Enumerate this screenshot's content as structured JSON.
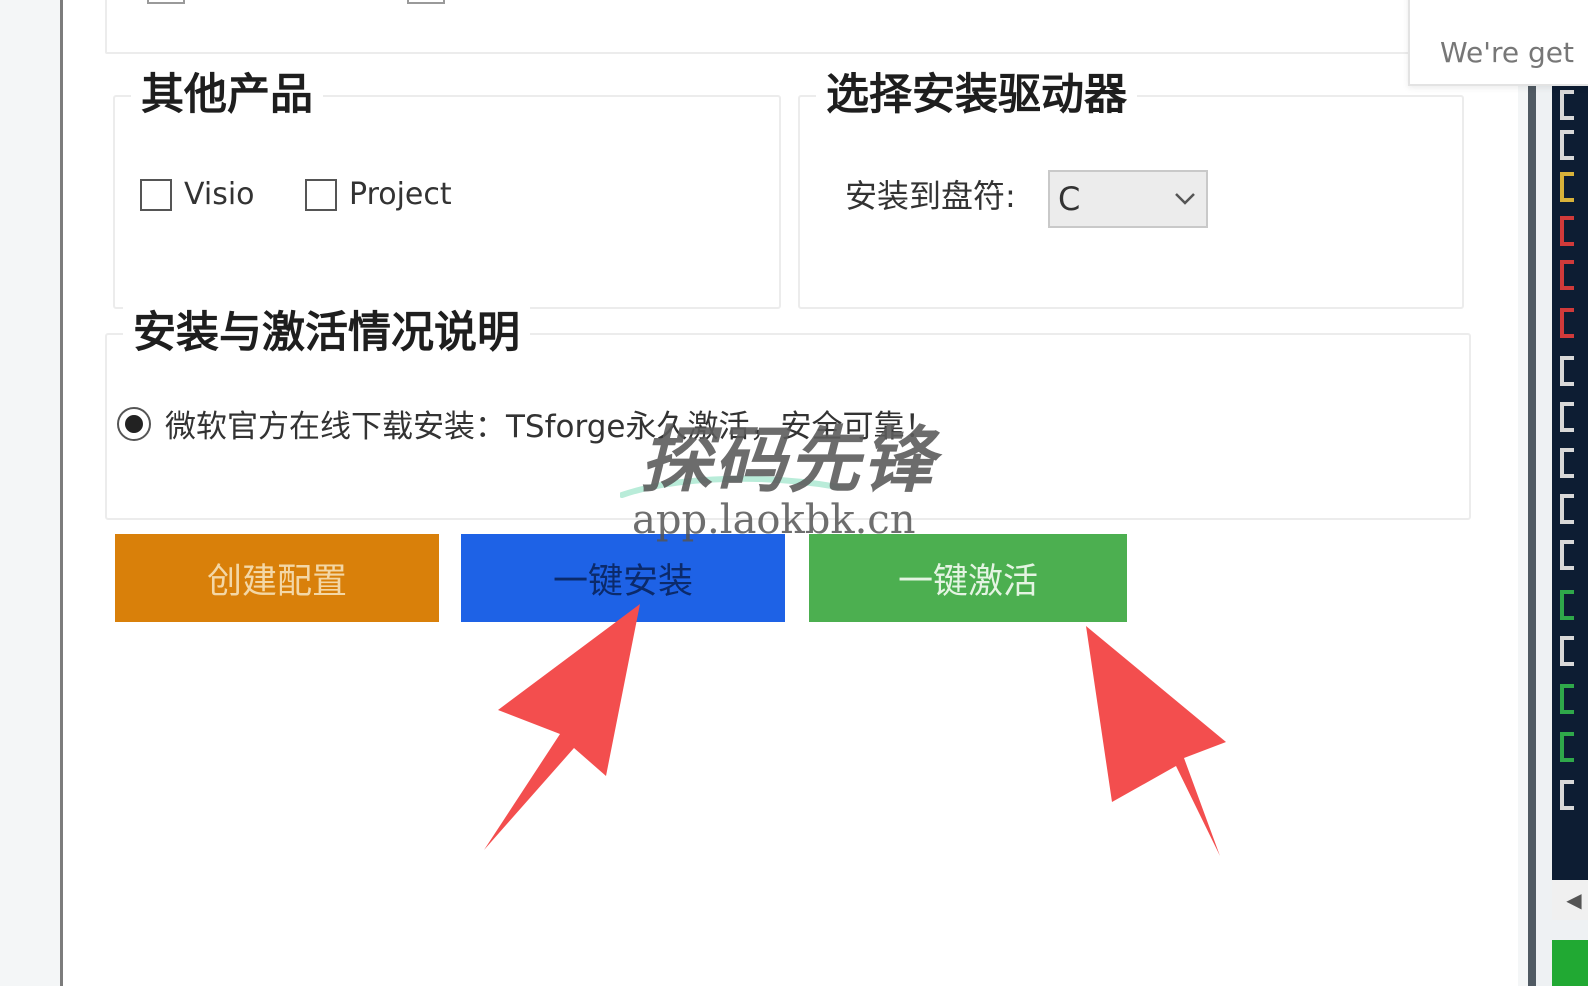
{
  "other_products": {
    "title": "其他产品",
    "checkboxes": [
      {
        "label": "Visio",
        "checked": false
      },
      {
        "label": "Project",
        "checked": false
      }
    ]
  },
  "drive": {
    "title": "选择安装驱动器",
    "label": "安装到盘符:",
    "selected": "C"
  },
  "info": {
    "title": "安装与激活情况说明",
    "option_text": "微软官方在线下载安装：TSforge永久激活，安全可靠！",
    "option_selected": true
  },
  "actions": {
    "create_config": "创建配置",
    "one_click_install": "一键安装",
    "one_click_activate": "一键激活"
  },
  "popup": {
    "text": "We're get"
  },
  "watermark": {
    "title": "探码先锋",
    "url": "app.laokbk.cn"
  },
  "colors": {
    "create_config_bg": "#d9800a",
    "create_config_text": "#f3d7a6",
    "install_bg": "#1e62e6",
    "install_text": "#0b2a6b",
    "activate_bg": "#4caf50",
    "activate_text": "#e4f4e2",
    "arrow": "#f34e4e",
    "console_bg": "#0d1d33",
    "status_green": "#21a933"
  }
}
